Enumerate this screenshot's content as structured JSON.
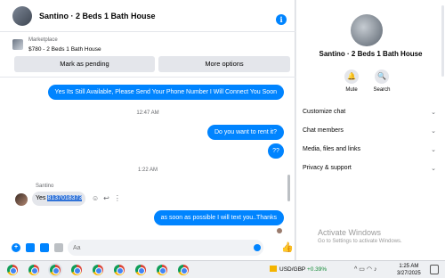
{
  "header": {
    "title": "Santino · 2 Beds 1 Bath House"
  },
  "listing": {
    "label": "Marketplace",
    "price_title": "$780 - 2 Beds 1 Bath House"
  },
  "actions": {
    "pending": "Mark as pending",
    "more": "More options"
  },
  "messages": {
    "out1": "Yes Its Still Available, Please Send Your Phone Number I Will Connect You Soon",
    "time1": "12:47 AM",
    "out2": "Do you want to rent it?",
    "out3": "??",
    "time2": "1:22 AM",
    "sender": "Santino",
    "in_prefix": "Yes ",
    "in_number": "8137018373",
    "out4": "as soon as possible I will text you..Thanks"
  },
  "composer": {
    "placeholder": "Aa"
  },
  "sidebar": {
    "title": "Santino · 2 Beds 1 Bath House",
    "mute": "Mute",
    "search": "Search",
    "items": [
      "Customize chat",
      "Chat members",
      "Media, files and links",
      "Privacy & support"
    ]
  },
  "watermark": {
    "title": "Activate Windows",
    "subtitle": "Go to Settings to activate Windows."
  },
  "taskbar": {
    "ticker_pair": "USD/GBP",
    "ticker_change": "+0.39%",
    "time": "1:25 AM",
    "date": "3/27/2025"
  },
  "colors": {
    "accent": "#0084ff",
    "selection": "#3173d8"
  }
}
